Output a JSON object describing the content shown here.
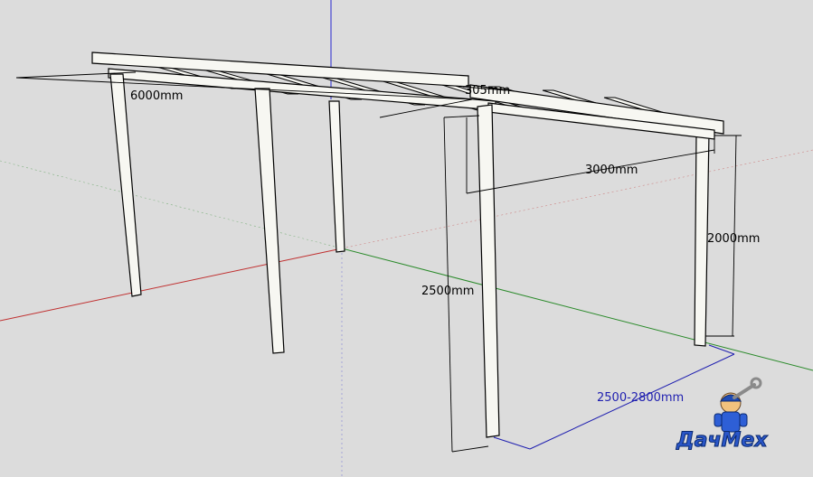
{
  "dimensions": {
    "length": "6000mm",
    "overhang": "305mm",
    "depth": "3000mm",
    "front_height": "2500mm",
    "back_height": "2000mm",
    "offset": "2500-2800mm"
  },
  "logo": {
    "text": "ДачМех"
  },
  "colors": {
    "background": "#dcdcdc",
    "axis_red": "#c03030",
    "axis_green": "#2a8a2a",
    "axis_blue": "#2a2ad0",
    "dimension_blue": "#1f1fb0",
    "wood_face": "#f7f7f2",
    "outline": "#000000"
  },
  "icons": [
    "mechanic-mascot-icon",
    "wrench-icon"
  ]
}
